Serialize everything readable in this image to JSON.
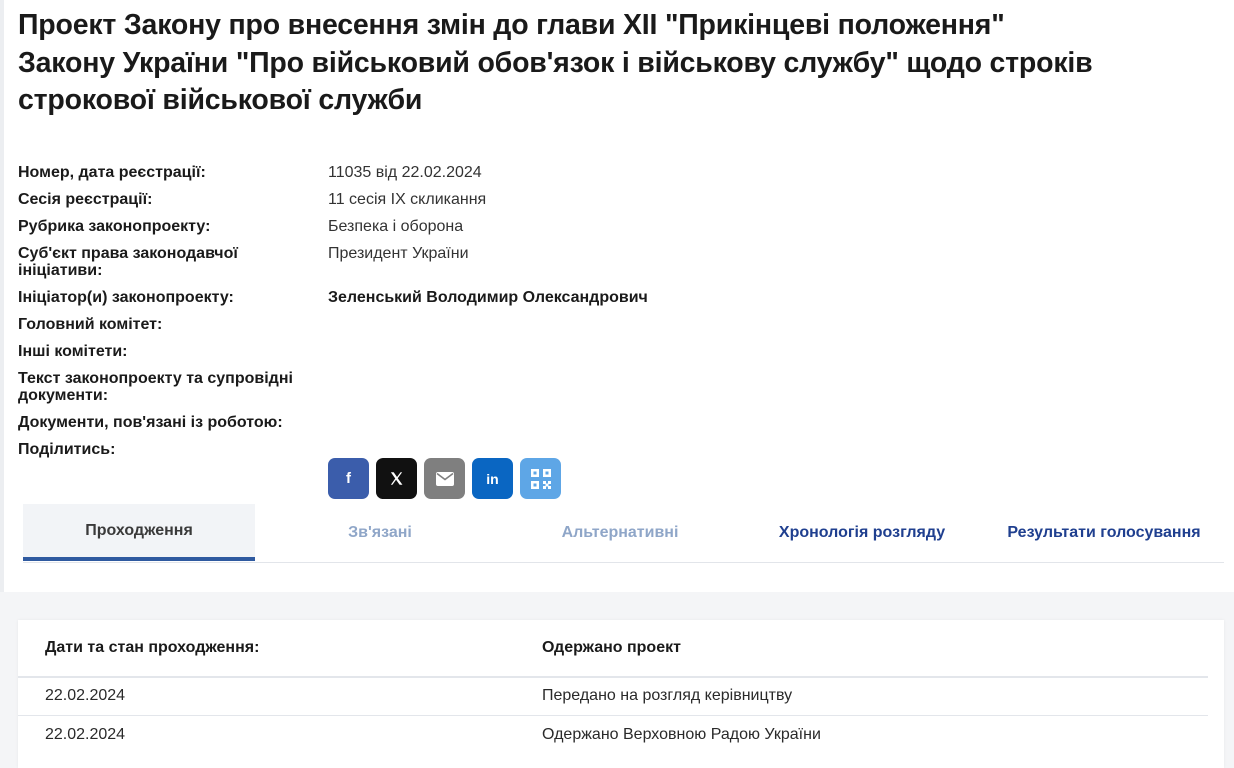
{
  "bill": {
    "title": "Проект Закону про внесення змін до глави XII \"Прикінцеві положення\" Закону України \"Про військовий обов'язок і військову службу\" щодо строків строкової військової служби"
  },
  "info": [
    {
      "label": "Номер, дата реєстрації:",
      "value": "11035 від 22.02.2024"
    },
    {
      "label": "Сесія реєстрації:",
      "value": "11 сесія IX скликання"
    },
    {
      "label": "Рубрика законопроекту:",
      "value": "Безпека і оборона"
    },
    {
      "label": "Суб'єкт права законодавчої ініціативи:",
      "value": "Президент України"
    },
    {
      "label": "Ініціатор(и) законопроекту:",
      "value": "Зеленський Володимир Олександрович"
    },
    {
      "label": "Головний комітет:",
      "value": ""
    },
    {
      "label": "Інші комітети:",
      "value": ""
    },
    {
      "label": "Текст законопроекту та супровідні документи:",
      "value": ""
    },
    {
      "label": "Документи, пов'язані із роботою:",
      "value": ""
    },
    {
      "label": "Поділитись:",
      "value": ""
    }
  ],
  "share": {
    "facebook_label": "f",
    "linkedin_label": "in",
    "colors": {
      "facebook": "#3b5dab",
      "x": "#111111",
      "email": "#7f7f7f",
      "linkedin": "#0a66c2",
      "qr": "#5ea6e6"
    }
  },
  "tabs": [
    {
      "label": "Проходження"
    },
    {
      "label": "Зв'язані"
    },
    {
      "label": "Альтернативні"
    },
    {
      "label": "Хронологія розгляду"
    },
    {
      "label": "Результати голосування"
    }
  ],
  "passage": {
    "header_date": "Дати та стан проходження:",
    "header_status": "Одержано проект",
    "rows": [
      {
        "date": "22.02.2024",
        "status": "Передано на розгляд керівництву"
      },
      {
        "date": "22.02.2024",
        "status": "Одержано Верховною Радою України"
      }
    ]
  }
}
